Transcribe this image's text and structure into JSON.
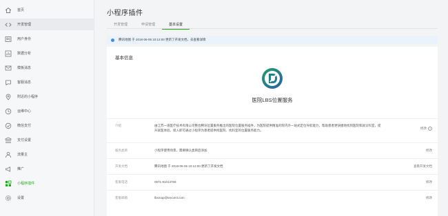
{
  "sidebar": {
    "items": [
      {
        "label": "首页",
        "icon": "home-icon"
      },
      {
        "label": "开发管理",
        "icon": "code-icon",
        "active": true
      },
      {
        "label": "用户身份",
        "icon": "user-icon"
      },
      {
        "label": "数据分析",
        "icon": "chart-icon"
      },
      {
        "label": "模板消息",
        "icon": "message-icon"
      },
      {
        "label": "客服消息",
        "icon": "chat-icon"
      },
      {
        "label": "附近的小程序",
        "icon": "location-icon"
      },
      {
        "label": "运维中心",
        "icon": "monitor-icon"
      },
      {
        "label": "微信支付",
        "icon": "wechat-pay-icon"
      },
      {
        "label": "支付设置",
        "icon": "wallet-icon"
      },
      {
        "label": "流量主",
        "icon": "traffic-icon"
      },
      {
        "label": "推广",
        "icon": "megaphone-icon"
      },
      {
        "label": "小程序插件",
        "icon": "plugin-icon",
        "current": true
      },
      {
        "label": "设置",
        "icon": "gear-icon"
      }
    ]
  },
  "header": {
    "title": "小程序插件"
  },
  "tabs": [
    {
      "label": "开发管理"
    },
    {
      "label": "申请管理"
    },
    {
      "label": "基本设置",
      "active": true
    }
  ],
  "notice": {
    "text": "腾讯地图 于 2018-06-06 10:12:00 更新了开发文档，去查看详情"
  },
  "card": {
    "title": "基本信息",
    "plugin_name": "医院LBS位置服务",
    "rows": [
      {
        "key": "介绍",
        "value": "由江苏一道医疗技术有限公司整合腾讯位置服务推出的医院位置服务插件，为医院提供精准的院内外一站式定位导航能力，帮助患者更快捷地找到医院和就诊科室，提升就医体验。接入即可通过小程序为患者提供找医院、找科室的位置服务能力。",
        "action": "修改"
      },
      {
        "key": "服务类目",
        "value": "小程序使用场景，需要确认类目后添加",
        "action": "修改"
      },
      {
        "key": "开发文档",
        "value": "腾讯地图 于 2018-06-06 10:12:00 更新了开发文档",
        "action": "查看开发文档"
      },
      {
        "key": "客服电话",
        "value": "0571-81013769",
        "action": "修改"
      },
      {
        "key": "客服邮箱",
        "value": "lbsmap@tencent.com",
        "action": "修改"
      }
    ]
  },
  "colors": {
    "accent": "#1aad19",
    "logo_green": "#1e9a6e",
    "logo_blue": "#2b5fa6",
    "notice_dot": "#3a8ee6"
  }
}
